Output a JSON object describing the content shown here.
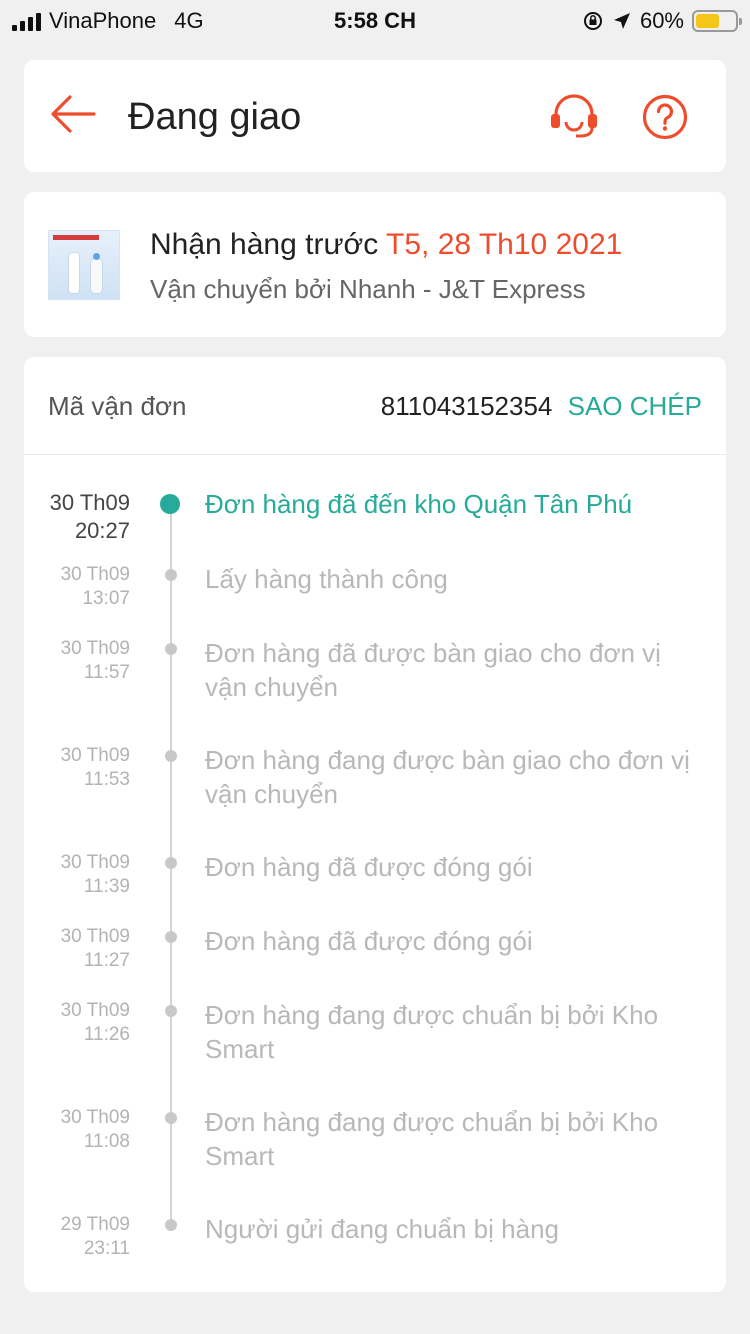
{
  "status_bar": {
    "carrier": "VinaPhone",
    "network": "4G",
    "time": "5:58 CH",
    "battery": "60%",
    "battery_level": 0.6,
    "icons": [
      "signal-icon",
      "orientation-lock-icon",
      "location-arrow-icon",
      "battery-icon"
    ]
  },
  "header": {
    "title": "Đang giao",
    "icons": [
      "back-arrow-icon",
      "headset-support-icon",
      "help-icon"
    ],
    "accent_color": "#ee4d2d"
  },
  "delivery": {
    "receive_prefix": "Nhận hàng trước",
    "receive_date": "T5, 28 Th10 2021",
    "shipping_by": "Vận chuyển bởi Nhanh - J&T Express"
  },
  "tracking": {
    "waybill_label": "Mã vận đơn",
    "waybill_number": "811043152354",
    "copy_label": "SAO CHÉP",
    "events": [
      {
        "date": "30 Th09",
        "time": "20:27",
        "text": "Đơn hàng đã đến kho Quận Tân Phú"
      },
      {
        "date": "30 Th09",
        "time": "13:07",
        "text": "Lấy hàng thành công"
      },
      {
        "date": "30 Th09",
        "time": "11:57",
        "text": "Đơn hàng đã được bàn giao cho đơn vị vận chuyển"
      },
      {
        "date": "30 Th09",
        "time": "11:53",
        "text": "Đơn hàng đang được bàn giao cho đơn vị vận chuyển"
      },
      {
        "date": "30 Th09",
        "time": "11:39",
        "text": "Đơn hàng đã được đóng gói"
      },
      {
        "date": "30 Th09",
        "time": "11:27",
        "text": "Đơn hàng đã được đóng gói"
      },
      {
        "date": "30 Th09",
        "time": "11:26",
        "text": "Đơn hàng đang được chuẩn bị bởi Kho Smart"
      },
      {
        "date": "30 Th09",
        "time": "11:08",
        "text": "Đơn hàng đang được chuẩn bị bởi Kho Smart"
      },
      {
        "date": "29 Th09",
        "time": "23:11",
        "text": "Người gửi đang chuẩn bị hàng"
      }
    ],
    "current_color": "#26aa99"
  }
}
